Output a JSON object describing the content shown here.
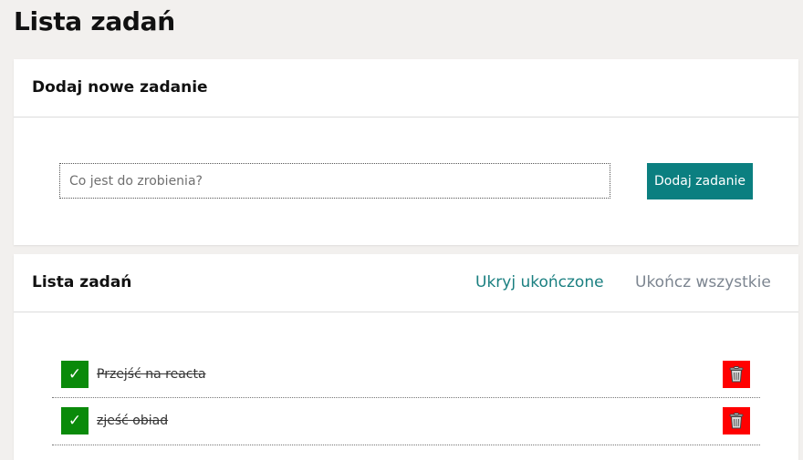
{
  "page": {
    "title": "Lista zadań"
  },
  "add_section": {
    "title": "Dodaj nowe zadanie",
    "input_placeholder": "Co jest do zrobienia?",
    "input_value": "",
    "button_label": "Dodaj zadanie"
  },
  "list_section": {
    "title": "Lista zadań",
    "hide_completed_label": "Ukryj ukończone",
    "complete_all_label": "Ukończ wszystkie",
    "tasks": [
      {
        "label": "Przejść na reacta",
        "completed": true,
        "check_glyph": "✓",
        "delete_icon": "trash-icon"
      },
      {
        "label": "zjeść obiad",
        "completed": true,
        "check_glyph": "✓",
        "delete_icon": "trash-icon"
      }
    ]
  },
  "colors": {
    "background": "#f2f0ee",
    "accent": "#0b7f80",
    "complete_green": "#0a8a0a",
    "delete_red": "#ff0000",
    "muted_link": "#7c8590"
  }
}
